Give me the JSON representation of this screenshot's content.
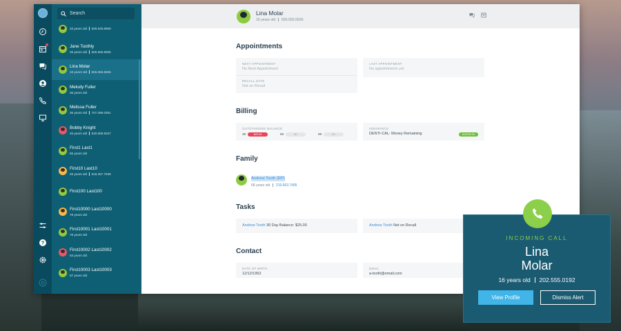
{
  "search": {
    "placeholder": "Search"
  },
  "contacts": [
    {
      "name": "",
      "age": "33 years old",
      "phone": "608.629.8959",
      "avatar": "#8ecb3e"
    },
    {
      "name": "Jane Toothly",
      "age": "25 years old",
      "phone": "555.555.5555",
      "avatar": "#8ecb3e"
    },
    {
      "name": "Lina Molar",
      "age": "16 years old",
      "phone": "555.555.5555",
      "avatar": "#8ecb3e"
    },
    {
      "name": "Melody Fuller",
      "age": "36 years old",
      "phone": "",
      "avatar": "#8ecb3e"
    },
    {
      "name": "Melissa Fuller",
      "age": "36 years old",
      "phone": "707.396.0351",
      "avatar": "#8ecb3e"
    },
    {
      "name": "Bobby Knight",
      "age": "45 years old",
      "phone": "630.808.5037",
      "avatar": "#e6576a"
    },
    {
      "name": "First1 Last1",
      "age": "55 years old",
      "phone": "",
      "avatar": "#8ecb3e"
    },
    {
      "name": "First10 Last10",
      "age": "26 years old",
      "phone": "618.267.7838",
      "avatar": "#f4b84a"
    },
    {
      "name": "First100 Last100",
      "age": "",
      "phone": "",
      "avatar": "#8ecb3e"
    },
    {
      "name": "First10000 Last10000",
      "age": "78 years old",
      "phone": "",
      "avatar": "#f4b84a"
    },
    {
      "name": "First10001 Last10001",
      "age": "78 years old",
      "phone": "",
      "avatar": "#8ecb3e"
    },
    {
      "name": "First10002 Last10002",
      "age": "63 years old",
      "phone": "",
      "avatar": "#e6576a"
    },
    {
      "name": "First10003 Last10003",
      "age": "67 years old",
      "phone": "",
      "avatar": "#8ecb3e"
    }
  ],
  "patient": {
    "name": "Lina Molar",
    "age": "16 years old",
    "phone": "555.555.5555"
  },
  "appointments": {
    "title": "Appointments",
    "next_label": "NEXT APPOINTMENT",
    "next_value": "No Next Appointment",
    "last_label": "LAST APPOINTMENT",
    "last_value": "No appointments yet",
    "recall_label": "RECALL DATE",
    "recall_value": "Not on Recall"
  },
  "billing": {
    "title": "Billing",
    "balance_label": "OUTSTANDING BALANCE",
    "b30_label": "30",
    "b30_value": "$25.00",
    "b60_label": "60",
    "b60_value": "$0",
    "b90_label": "90",
    "b90_value": "$0",
    "insurance_label": "INSURANCE",
    "insurance_value": "DENTI-CAL: Money Remaining",
    "insurance_amount": "$10000.00"
  },
  "family": {
    "title": "Family",
    "member_name": "Andrew Tooth (RP)",
    "member_age": "68 years old",
    "member_phone": "219.663.7495"
  },
  "tasks": {
    "title": "Tasks",
    "t1_name": "Andrew Tooth",
    "t1_text": "30 Day Balance: $25.00",
    "t2_name": "Andrew Tooth",
    "t2_text": "Not on Recall"
  },
  "contact": {
    "title": "Contact",
    "dob_label": "DATE OF BIRTH",
    "dob_value": "12/12/1952",
    "email_label": "EMAIL",
    "email_value": "a-tooth@email.com"
  },
  "incoming_call": {
    "label": "INCOMING CALL",
    "first_name": "Lina",
    "last_name": "Molar",
    "age": "16 years old",
    "phone": "202.555.0192",
    "view_button": "View Profile",
    "dismiss_button": "Dismiss Alert"
  },
  "colors": {
    "rail": "#0a4a5e",
    "list": "#0f5f74",
    "accent_green": "#8ccf4a",
    "accent_blue": "#41b5e8",
    "alert_red": "#e84459"
  }
}
